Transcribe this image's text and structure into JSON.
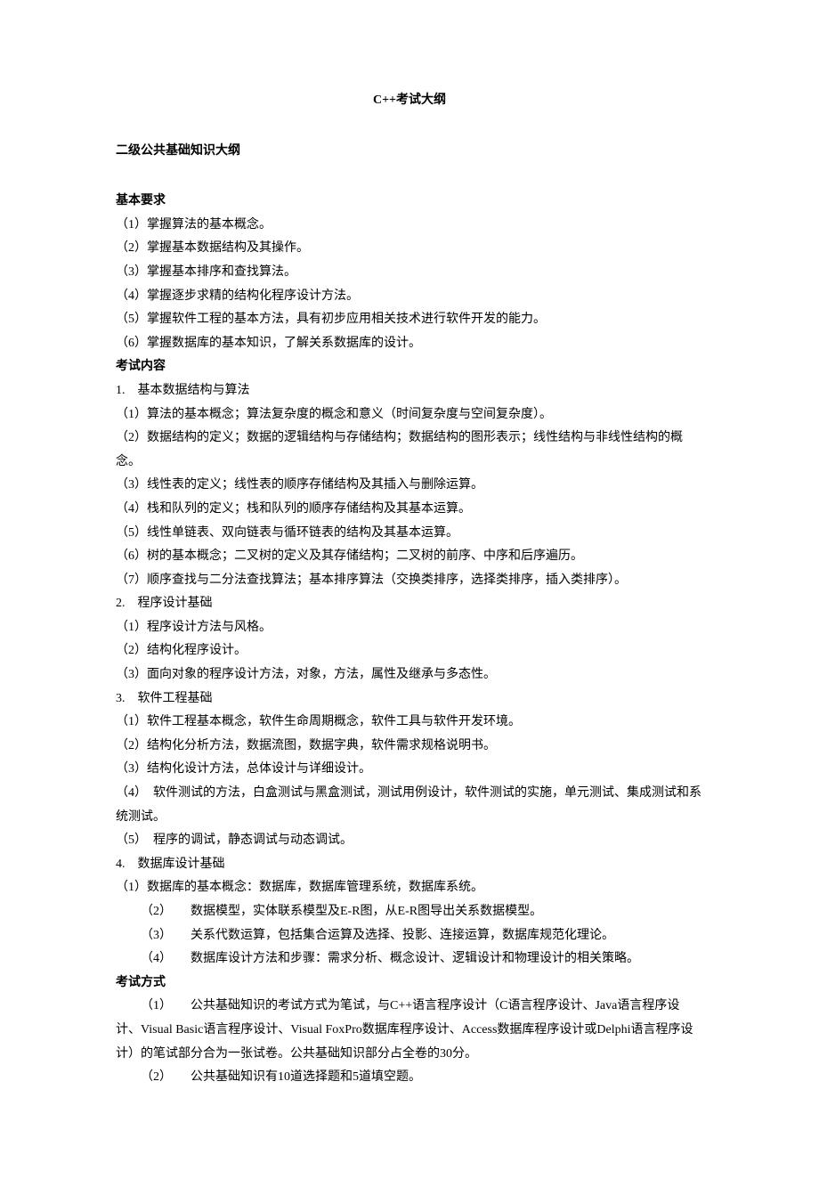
{
  "title": "C++考试大纲",
  "section1_title": "二级公共基础知识大纲",
  "basic_req_heading": "基本要求",
  "basic_req": [
    "（1）掌握算法的基本概念。",
    "（2）掌握基本数据结构及其操作。",
    "（3）掌握基本排序和查找算法。",
    "（4）掌握逐步求精的结构化程序设计方法。",
    "（5）掌握软件工程的基本方法，具有初步应用相关技术进行软件开发的能力。",
    "（6）掌握数据库的基本知识，了解关系数据库的设计。"
  ],
  "exam_content_heading": "考试内容",
  "topic1_title": "1.　基本数据结构与算法",
  "topic1_items": [
    "（1）算法的基本概念；算法复杂度的概念和意义（时间复杂度与空间复杂度）。",
    "（2）数据结构的定义；数据的逻辑结构与存储结构；数据结构的图形表示；线性结构与非线性结构的概念。",
    "（3）线性表的定义；线性表的顺序存储结构及其插入与删除运算。",
    "（4）栈和队列的定义；栈和队列的顺序存储结构及其基本运算。",
    "（5）线性单链表、双向链表与循环链表的结构及其基本运算。",
    "（6）树的基本概念；二叉树的定义及其存储结构；二叉树的前序、中序和后序遍历。",
    "（7）顺序查找与二分法查找算法；基本排序算法（交换类排序，选择类排序，插入类排序）。"
  ],
  "topic2_title": "2.　程序设计基础",
  "topic2_items": [
    "（1）程序设计方法与风格。",
    "（2）结构化程序设计。",
    "（3）面向对象的程序设计方法，对象，方法，属性及继承与多态性。"
  ],
  "topic3_title": "3.　软件工程基础",
  "topic3_items": [
    "（1）软件工程基本概念，软件生命周期概念，软件工具与软件开发环境。",
    "（2）结构化分析方法，数据流图，数据字典，软件需求规格说明书。",
    "（3）结构化设计方法，总体设计与详细设计。",
    "（4）　软件测试的方法，白盒测试与黑盒测试，测试用例设计，软件测试的实施，单元测试、集成测试和系统测试。",
    "（5）　程序的调试，静态调试与动态调试。"
  ],
  "topic4_title": "4.　数据库设计基础",
  "topic4_items": [
    "（1）数据库的基本概念：数据库，数据库管理系统，数据库系统。",
    "（2）　　数据模型，实体联系模型及E-R图，从E-R图导出关系数据模型。",
    "（3）　　关系代数运算，包括集合运算及选择、投影、连接运算，数据库规范化理论。",
    "（4）　　数据库设计方法和步骤：需求分析、概念设计、逻辑设计和物理设计的相关策略。"
  ],
  "exam_method_heading": "考试方式",
  "exam_method_items": [
    "（1）　　公共基础知识的考试方式为笔试，与C++语言程序设计（C语言程序设计、Java语言程序设计、Visual Basic语言程序设计、Visual FoxPro数据库程序设计、Access数据库程序设计或Delphi语言程序设计）的笔试部分合为一张试卷。公共基础知识部分占全卷的30分。",
    "（2）　　公共基础知识有10道选择题和5道填空题。"
  ]
}
